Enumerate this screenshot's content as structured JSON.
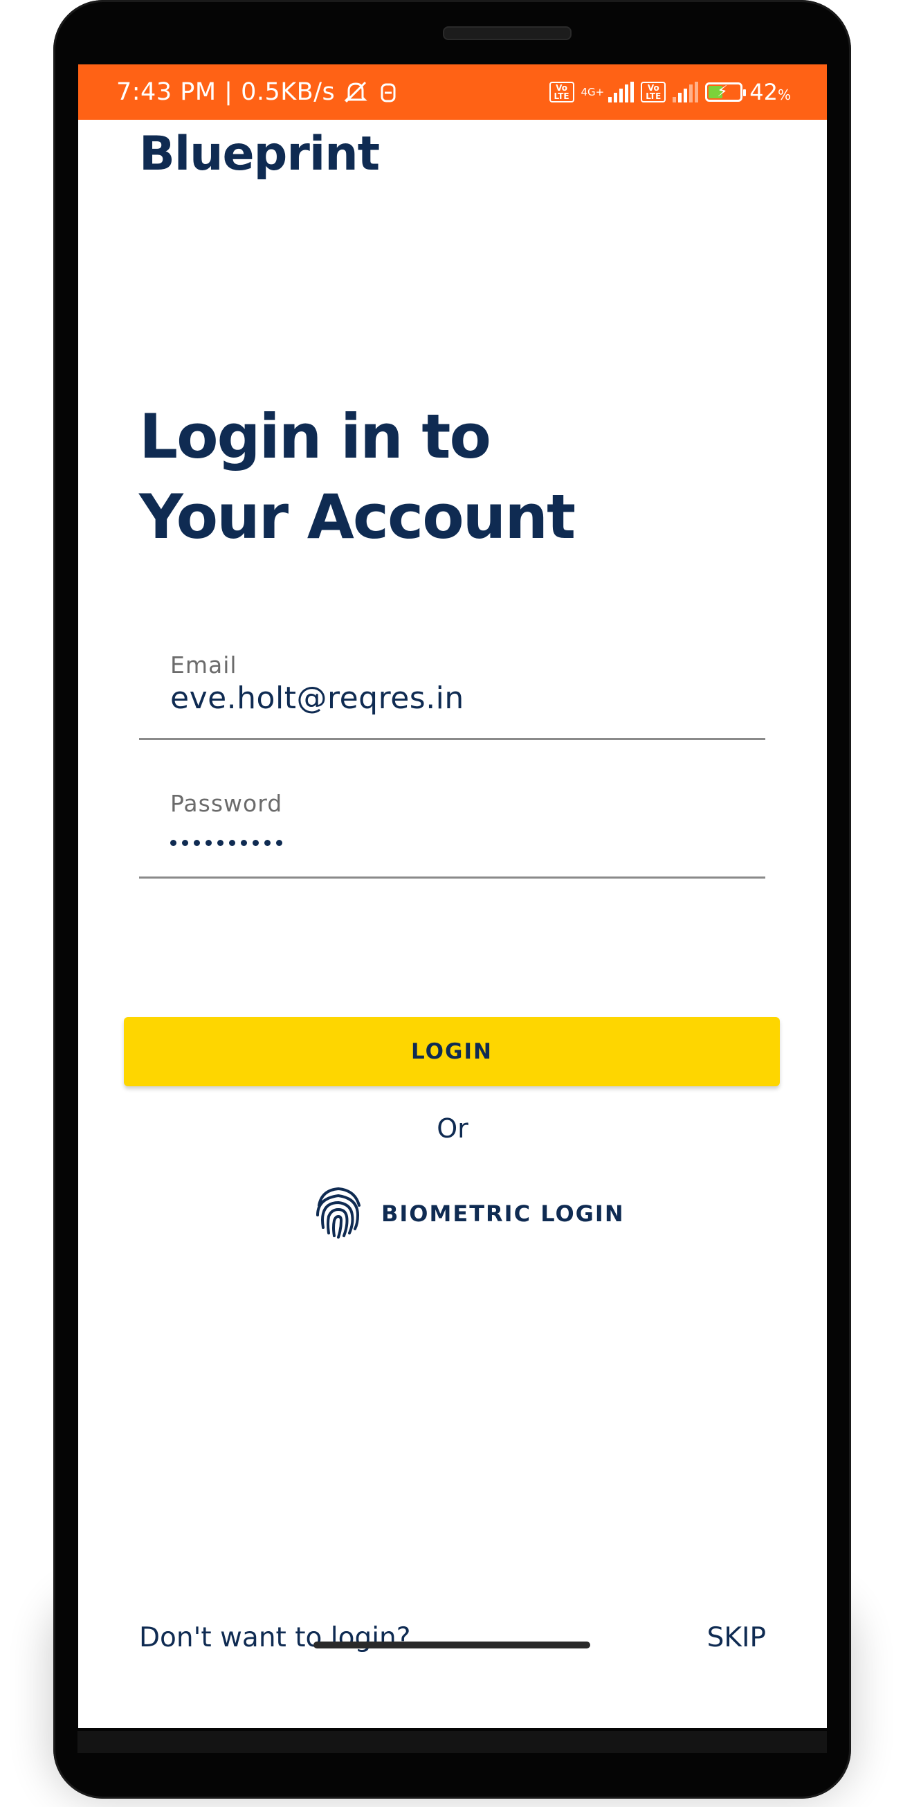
{
  "status_bar": {
    "time_speed": "7:43 PM | 0.5KB/s",
    "network_type": "4G+",
    "volte_label": "Vo LTE",
    "battery_percent": "42",
    "battery_percent_sign": "%",
    "battery_level": 0.42,
    "color": "#ff6215"
  },
  "app": {
    "brand": "Blueprint",
    "headline_line1": "Login in to",
    "headline_line2": "Your Account"
  },
  "form": {
    "email_label": "Email",
    "email_value": "eve.holt@reqres.in",
    "password_label": "Password",
    "password_masked_length": 10,
    "login_button": "LOGIN",
    "or_text": "Or",
    "biometric_label": "BIOMETRIC LOGIN"
  },
  "footer": {
    "question": "Don't want to login?",
    "skip": "SKIP"
  },
  "colors": {
    "primary": "#0f2b52",
    "accent_button": "#fed600",
    "status_bar": "#ff6215"
  },
  "icons": [
    "mute-icon",
    "alarm-icon",
    "volte-icon",
    "signal-icon",
    "battery-icon",
    "fingerprint-icon"
  ]
}
